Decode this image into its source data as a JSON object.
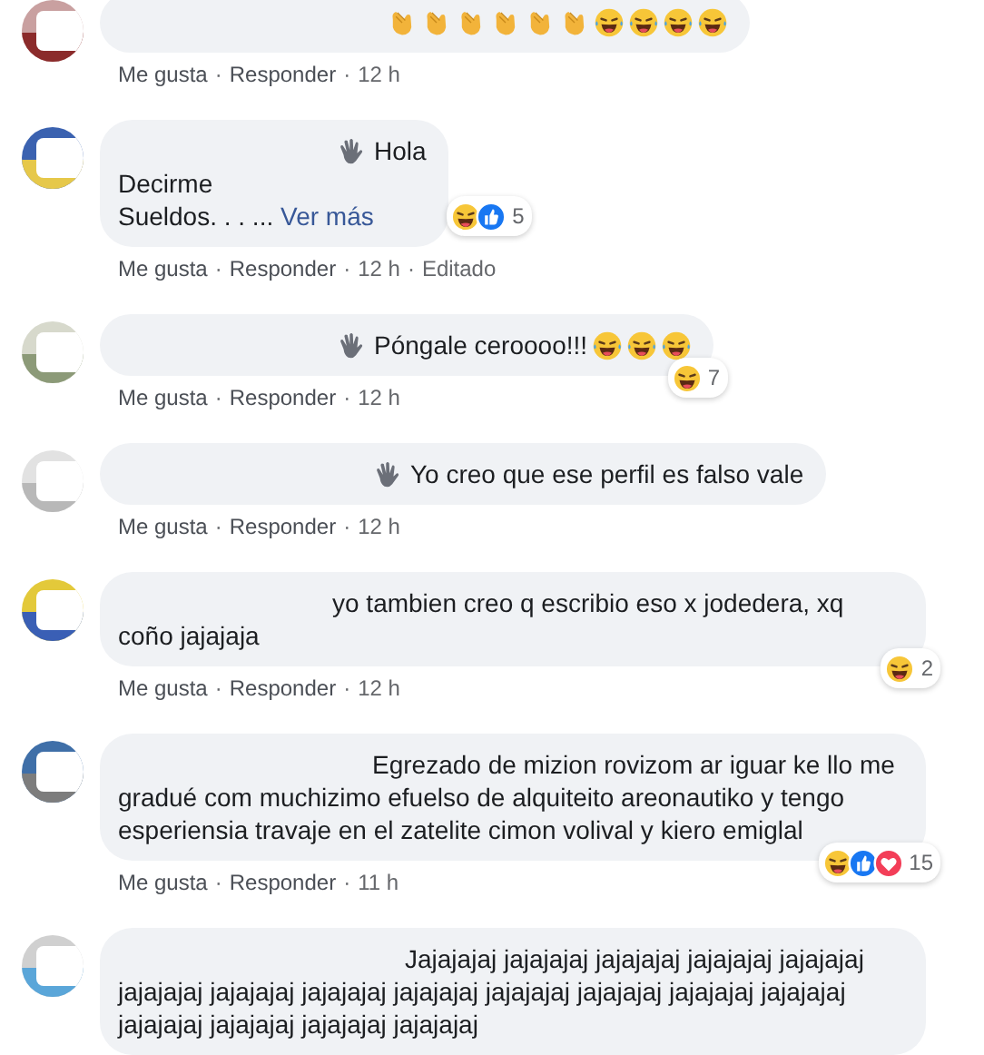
{
  "separator": "·",
  "comments": [
    {
      "body": [
        {
          "kind": "row",
          "items": [
            {
              "kind": "clap"
            },
            {
              "kind": "clap"
            },
            {
              "kind": "clap"
            },
            {
              "kind": "clap"
            },
            {
              "kind": "clap"
            },
            {
              "kind": "clap"
            },
            {
              "kind": "laugh"
            },
            {
              "kind": "laugh"
            },
            {
              "kind": "laugh"
            },
            {
              "kind": "laugh"
            }
          ]
        }
      ],
      "meta": [
        {
          "kind": "like",
          "text": "Me gusta"
        },
        {
          "kind": "reply",
          "text": "Responder"
        },
        {
          "kind": "time",
          "text": "12 h"
        }
      ]
    },
    {
      "body": [
        {
          "kind": "row",
          "items": [
            {
              "kind": "wave"
            },
            {
              "kind": "text",
              "text": "Hola"
            }
          ]
        },
        {
          "kind": "paragraph",
          "items": [
            {
              "kind": "text",
              "text": "Decirme\nSueldos. . . ... "
            },
            {
              "kind": "link",
              "text": "Ver más"
            }
          ]
        }
      ],
      "reactions": [
        {
          "kind": "laugh"
        },
        {
          "kind": "like"
        }
      ],
      "count": "5",
      "meta": [
        {
          "kind": "like",
          "text": "Me gusta"
        },
        {
          "kind": "reply",
          "text": "Responder"
        },
        {
          "kind": "time",
          "text": "12 h"
        },
        {
          "kind": "edited",
          "text": "Editado"
        }
      ]
    },
    {
      "body": [
        {
          "kind": "row",
          "items": [
            {
              "kind": "wave"
            },
            {
              "kind": "text",
              "text": "Póngale ceroooo!!!"
            },
            {
              "kind": "laugh"
            },
            {
              "kind": "laugh"
            },
            {
              "kind": "laugh"
            }
          ]
        }
      ],
      "reactions": [
        {
          "kind": "laugh"
        }
      ],
      "count": "7",
      "meta": [
        {
          "kind": "like",
          "text": "Me gusta"
        },
        {
          "kind": "reply",
          "text": "Responder"
        },
        {
          "kind": "time",
          "text": "12 h"
        }
      ]
    },
    {
      "body": [
        {
          "kind": "row",
          "items": [
            {
              "kind": "wave"
            },
            {
              "kind": "text",
              "text": "Yo creo que ese perfil es falso vale"
            }
          ]
        }
      ],
      "meta": [
        {
          "kind": "like",
          "text": "Me gusta"
        },
        {
          "kind": "reply",
          "text": "Responder"
        },
        {
          "kind": "time",
          "text": "12 h"
        }
      ]
    },
    {
      "body": [
        {
          "kind": "paragraph",
          "items": [
            {
              "kind": "text",
              "text": "yo tambien creo q escribio eso x jodedera, xq coño jajajaja"
            }
          ]
        }
      ],
      "reactions": [
        {
          "kind": "laugh"
        }
      ],
      "count": "2",
      "meta": [
        {
          "kind": "like",
          "text": "Me gusta"
        },
        {
          "kind": "reply",
          "text": "Responder"
        },
        {
          "kind": "time",
          "text": "12 h"
        }
      ]
    },
    {
      "body": [
        {
          "kind": "paragraph",
          "items": [
            {
              "kind": "text",
              "text": "Egrezado de mizion rovizom ar iguar ke llo me gradué com muchizimo efuelso de alquiteito areonautiko y tengo esperiensia travaje en el zatelite cimon volival y kiero emiglal"
            }
          ]
        }
      ],
      "reactions": [
        {
          "kind": "laugh"
        },
        {
          "kind": "like"
        },
        {
          "kind": "love"
        }
      ],
      "count": "15",
      "meta": [
        {
          "kind": "like",
          "text": "Me gusta"
        },
        {
          "kind": "reply",
          "text": "Responder"
        },
        {
          "kind": "time",
          "text": "11 h"
        }
      ]
    },
    {
      "body": [
        {
          "kind": "paragraph",
          "items": [
            {
              "kind": "text",
              "text": "Jajajajaj jajajajaj jajajajaj jajajajaj jajajajaj jajajajaj jajajajaj jajajajaj jajajajaj jajajajaj jajajajaj jajajajaj jajajajaj jajajajaj jajajajaj jajajajaj jajajajaj"
            }
          ]
        }
      ]
    }
  ]
}
